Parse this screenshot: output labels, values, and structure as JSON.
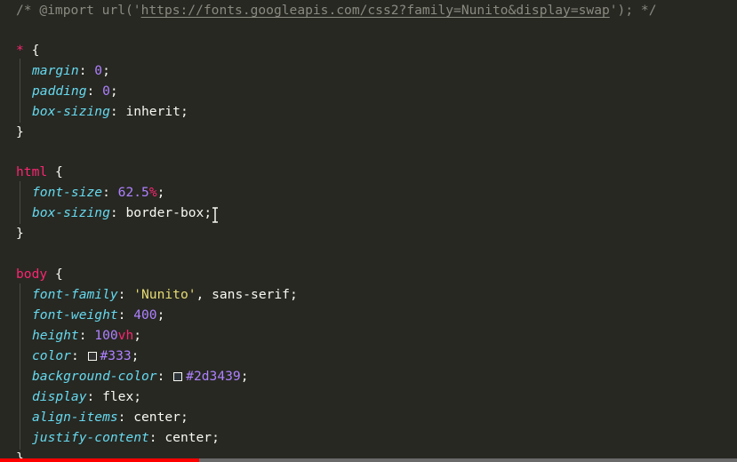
{
  "code": {
    "import_prefix": "/* @import url('",
    "import_url": "https://fonts.googleapis.com/css2?family=Nunito&display=swap",
    "import_suffix": "'); */",
    "universal": {
      "selector": "*",
      "brace_open": "{",
      "brace_close": "}",
      "decls": [
        {
          "prop": "margin",
          "value": "0"
        },
        {
          "prop": "padding",
          "value": "0"
        },
        {
          "prop": "box-sizing",
          "value": "inherit"
        }
      ]
    },
    "html_rule": {
      "selector": "html",
      "brace_open": "{",
      "brace_close": "}",
      "font_size_prop": "font-size",
      "font_size_num": "62.5",
      "font_size_unit": "%",
      "box_sizing_prop": "box-sizing",
      "box_sizing_value": "border-box"
    },
    "body_rule": {
      "selector": "body",
      "brace_open": "{",
      "brace_close": "}",
      "font_family_prop": "font-family",
      "font_family_string": "'Nunito'",
      "font_family_rest": "sans-serif",
      "font_weight_prop": "font-weight",
      "font_weight_value": "400",
      "height_prop": "height",
      "height_num": "100",
      "height_unit": "vh",
      "color_prop": "color",
      "color_value": "#333",
      "bg_prop": "background-color",
      "bg_value": "#2d3439",
      "display_prop": "display",
      "display_value": "flex",
      "align_prop": "align-items",
      "align_value": "center",
      "justify_prop": "justify-content",
      "justify_value": "center"
    }
  },
  "colors": {
    "background": "#272822",
    "selector": "#f92672",
    "property": "#66d9ef",
    "number": "#ae81ff",
    "string": "#e6db74",
    "comment": "#8a8a80",
    "swatch_color": "#333333",
    "swatch_bg": "#2d3439"
  },
  "video_progress": {
    "fraction": 0.27,
    "played_color": "#ff0000"
  }
}
